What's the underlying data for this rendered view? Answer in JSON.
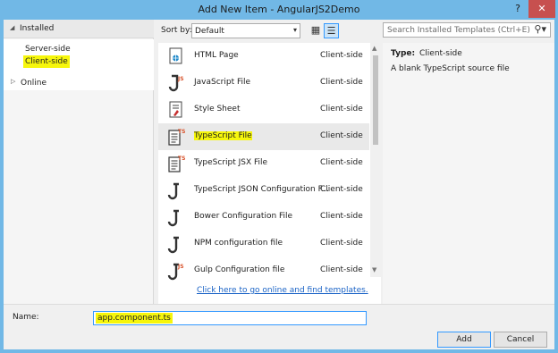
{
  "window": {
    "title": "Add New Item - AngularJS2Demo",
    "help_label": "?",
    "close_label": "✕"
  },
  "tree": {
    "header": "Installed",
    "items": [
      {
        "label": "Server-side",
        "highlighted": false
      },
      {
        "label": "Client-side",
        "highlighted": true
      }
    ],
    "online": "Online"
  },
  "toolbar": {
    "sort_label": "Sort by:",
    "sort_value": "Default"
  },
  "search": {
    "placeholder": "Search Installed Templates (Ctrl+E)"
  },
  "templates": [
    {
      "name": "HTML Page",
      "category": "Client-side",
      "icon": "html-file-icon",
      "selected": false,
      "highlighted": false
    },
    {
      "name": "JavaScript File",
      "category": "Client-side",
      "icon": "javascript-file-icon",
      "selected": false,
      "highlighted": false
    },
    {
      "name": "Style Sheet",
      "category": "Client-side",
      "icon": "stylesheet-file-icon",
      "selected": false,
      "highlighted": false
    },
    {
      "name": "TypeScript File",
      "category": "Client-side",
      "icon": "typescript-file-icon",
      "selected": true,
      "highlighted": true
    },
    {
      "name": "TypeScript JSX File",
      "category": "Client-side",
      "icon": "typescript-jsx-file-icon",
      "selected": false,
      "highlighted": false
    },
    {
      "name": "TypeScript JSON Configuration F...",
      "category": "Client-side",
      "icon": "json-config-file-icon",
      "selected": false,
      "highlighted": false
    },
    {
      "name": "Bower Configuration File",
      "category": "Client-side",
      "icon": "json-config-file-icon",
      "selected": false,
      "highlighted": false
    },
    {
      "name": "NPM configuration file",
      "category": "Client-side",
      "icon": "json-config-file-icon",
      "selected": false,
      "highlighted": false
    },
    {
      "name": "Gulp Configuration file",
      "category": "Client-side",
      "icon": "javascript-config-file-icon",
      "selected": false,
      "highlighted": false
    }
  ],
  "online_link": "Click here to go online and find templates.",
  "details": {
    "type_label": "Type:",
    "type_value": "Client-side",
    "description": "A blank TypeScript source file"
  },
  "name_field": {
    "label": "Name:",
    "value": "app.component.ts"
  },
  "buttons": {
    "add": "Add",
    "cancel": "Cancel"
  },
  "colors": {
    "titlebar": "#71b8e6",
    "highlight": "#f6f60c",
    "link": "#1a63c6",
    "close": "#c7504f"
  }
}
